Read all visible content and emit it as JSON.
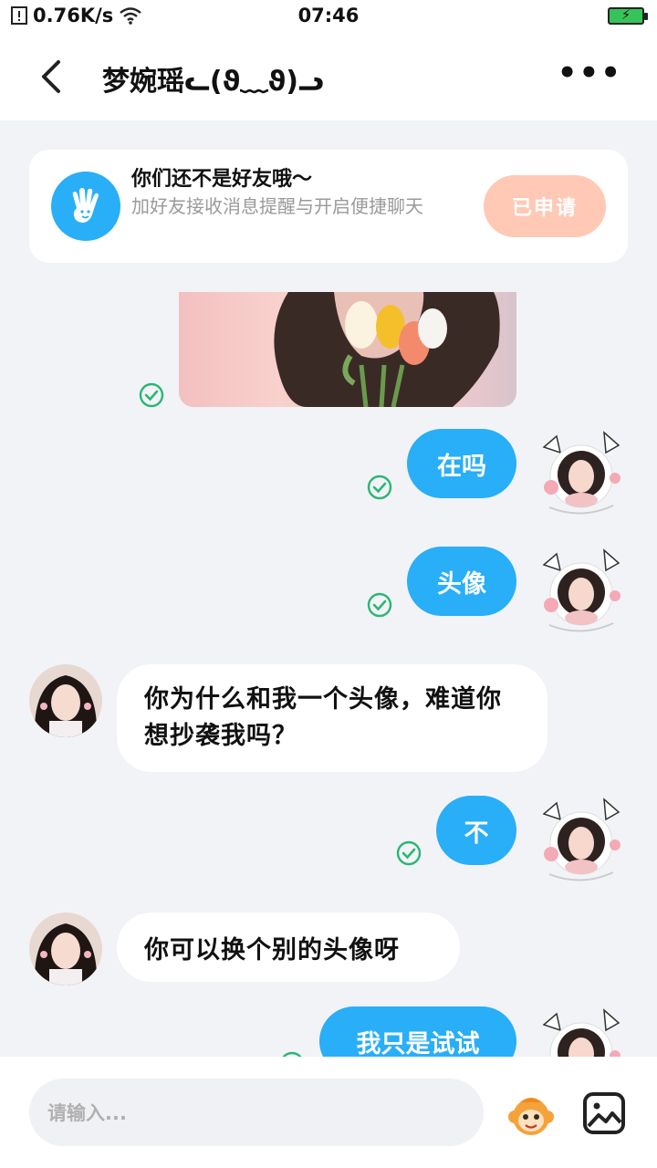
{
  "status_bar": {
    "network_speed": "0.76K/s",
    "time": "07:46",
    "battery_charging": "⚡"
  },
  "nav": {
    "title": "梦婉瑶ᓚ(ϑ﹏ϑ)ᓗ",
    "more": "•••"
  },
  "friend_card": {
    "title": "你们还不是好友哦～",
    "subtitle": "加好友接收消息提醒与开启便捷聊天",
    "button": "已申请"
  },
  "messages": [
    {
      "side": "out",
      "text": "在吗"
    },
    {
      "side": "out",
      "text": "头像"
    },
    {
      "side": "in",
      "text": "你为什么和我一个头像，难道你想抄袭我吗？"
    },
    {
      "side": "out",
      "text": "不"
    },
    {
      "side": "in",
      "text": "你可以换个别的头像呀"
    },
    {
      "side": "out",
      "text": "我只是试试"
    }
  ],
  "input": {
    "placeholder": "请输入..."
  },
  "colors": {
    "accent": "#29aef8",
    "check": "#2bb673",
    "applied_button": "#ffc9b5"
  }
}
